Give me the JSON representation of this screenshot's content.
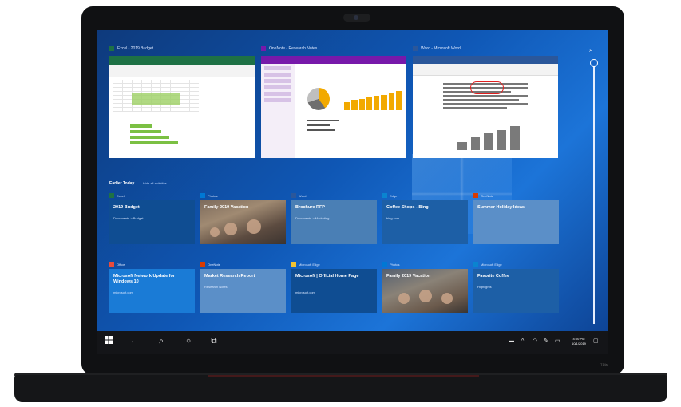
{
  "timeline": {
    "heading": "Earlier Today",
    "subheading": "Hide all activities",
    "windows": [
      {
        "app": "Excel",
        "caption": "Excel - 2019 Budget",
        "color": "#1e7145"
      },
      {
        "app": "OneNote",
        "caption": "OneNote - Research Notes",
        "color": "#7719aa"
      },
      {
        "app": "Word",
        "caption": "Word - Microsoft Word",
        "color": "#2b579a"
      }
    ],
    "row1": [
      {
        "app": "Excel",
        "title": "2019 Budget",
        "sub": "Documents > Budget",
        "bg": "#0f4d92"
      },
      {
        "app": "Photos",
        "title": "Family 2019 Vacation",
        "sub": "",
        "bg": "photo"
      },
      {
        "app": "Word",
        "title": "Brochure RFP",
        "sub": "Documents > Marketing",
        "bg": "#4a7fb5"
      },
      {
        "app": "Edge",
        "title": "Coffee Shops - Bing",
        "sub": "bing.com",
        "bg": "#1d5fa6"
      },
      {
        "app": "OneNote",
        "title": "Summer Holiday Ideas",
        "sub": "",
        "bg": "#5b8fc8"
      }
    ],
    "row2": [
      {
        "app": "Office",
        "title": "Microsoft Network Update for Windows 10",
        "sub": "microsoft.com",
        "bg": "#1a7bd6"
      },
      {
        "app": "OneNote",
        "title": "Market Research Report",
        "sub": "Research Notes",
        "bg": "#5b8fc8"
      },
      {
        "app": "Microsoft Edge",
        "title": "Microsoft | Official Home Page",
        "sub": "microsoft.com",
        "bg": "#0f4d92"
      },
      {
        "app": "Photos",
        "title": "Family 2019 Vacation",
        "sub": "",
        "bg": "photo"
      },
      {
        "app": "Microsoft Edge",
        "title": "Favorite Coffee",
        "sub": "Highlights",
        "bg": "#1d5fa6"
      }
    ]
  },
  "taskbar": {
    "icons": [
      "windows-icon",
      "back-icon",
      "search-icon",
      "cortana-icon",
      "task-view-icon"
    ],
    "tray": [
      "battery-icon",
      "chevron-icon",
      "wifi-icon",
      "pen-icon",
      "keyboard-icon"
    ],
    "clock_time": "4:00 PM",
    "clock_date": "10/1/2019"
  },
  "brand": "T14s"
}
